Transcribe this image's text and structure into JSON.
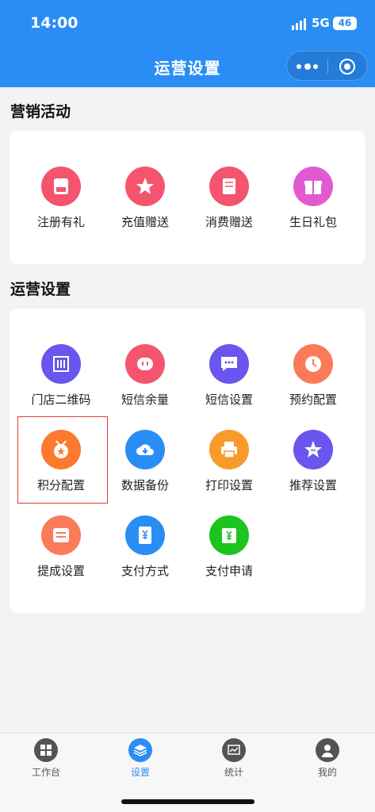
{
  "status_bar": {
    "time": "14:00",
    "network": "5G",
    "battery": "46"
  },
  "nav": {
    "title": "运营设置"
  },
  "marketing": {
    "title": "营销活动",
    "items": [
      {
        "label": "注册有礼",
        "icon": "register-gift-icon",
        "color": "#f5546f"
      },
      {
        "label": "充值赠送",
        "icon": "recharge-gift-icon",
        "color": "#f5546f"
      },
      {
        "label": "消费赠送",
        "icon": "consume-gift-icon",
        "color": "#f5546f"
      },
      {
        "label": "生日礼包",
        "icon": "birthday-gift-icon",
        "color": "#e25ad0"
      }
    ]
  },
  "operations": {
    "title": "运营设置",
    "items": [
      {
        "label": "门店二维码",
        "icon": "store-qrcode-icon",
        "color": "#6a55ee"
      },
      {
        "label": "短信余量",
        "icon": "sms-balance-icon",
        "color": "#f5546f"
      },
      {
        "label": "短信设置",
        "icon": "sms-settings-icon",
        "color": "#6a55ee"
      },
      {
        "label": "预约配置",
        "icon": "appointment-clock-icon",
        "color": "#fb7a5a"
      },
      {
        "label": "积分配置",
        "icon": "points-medal-icon",
        "color": "#fb7a2e"
      },
      {
        "label": "数据备份",
        "icon": "cloud-backup-icon",
        "color": "#2a8df6"
      },
      {
        "label": "打印设置",
        "icon": "printer-icon",
        "color": "#fa9a2a"
      },
      {
        "label": "推荐设置",
        "icon": "recommend-star-icon",
        "color": "#6a55ee"
      },
      {
        "label": "提成设置",
        "icon": "commission-doc-icon",
        "color": "#fb7a5a"
      },
      {
        "label": "支付方式",
        "icon": "payment-method-icon",
        "color": "#2a8df6"
      },
      {
        "label": "支付申请",
        "icon": "payment-apply-icon",
        "color": "#1ec41e"
      }
    ]
  },
  "tabbar": {
    "items": [
      {
        "label": "工作台",
        "icon": "workbench-grid-icon"
      },
      {
        "label": "设置",
        "icon": "settings-layers-icon",
        "active": true
      },
      {
        "label": "统计",
        "icon": "statistics-chart-icon"
      },
      {
        "label": "我的",
        "icon": "profile-user-icon"
      }
    ]
  },
  "colors": {
    "primary": "#2a8df6",
    "highlight_border": "#e53935"
  }
}
